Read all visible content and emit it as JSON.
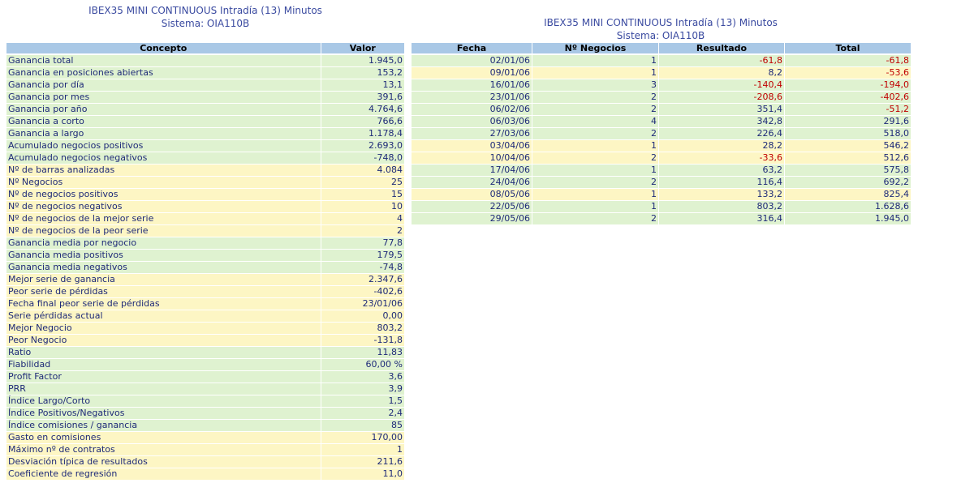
{
  "left": {
    "title": "IBEX35 MINI CONTINUOUS Intradía (13) Minutos",
    "subtitle": "Sistema: OIA110B",
    "headers": [
      "Concepto",
      "Valor"
    ],
    "rows": [
      {
        "label": "Ganancia total",
        "value": "1.945,0",
        "color": "g"
      },
      {
        "label": "Ganancia en posiciones abiertas",
        "value": "153,2",
        "color": "g"
      },
      {
        "label": "Ganancia por día",
        "value": "13,1",
        "color": "g"
      },
      {
        "label": "Ganancia por mes",
        "value": "391,6",
        "color": "g"
      },
      {
        "label": "Ganancia por año",
        "value": "4.764,6",
        "color": "g"
      },
      {
        "label": "Ganancia a corto",
        "value": "766,6",
        "color": "g"
      },
      {
        "label": "Ganancia a largo",
        "value": "1.178,4",
        "color": "g"
      },
      {
        "label": "Acumulado negocios positivos",
        "value": "2.693,0",
        "color": "g"
      },
      {
        "label": "Acumulado negocios negativos",
        "value": "-748,0",
        "color": "g"
      },
      {
        "label": "Nº de barras analizadas",
        "value": "4.084",
        "color": "y"
      },
      {
        "label": "Nº Negocios",
        "value": "25",
        "color": "y"
      },
      {
        "label": "Nº de negocios positivos",
        "value": "15",
        "color": "y"
      },
      {
        "label": "Nº de negocios negativos",
        "value": "10",
        "color": "y"
      },
      {
        "label": "Nº de negocios de la mejor serie",
        "value": "4",
        "color": "y"
      },
      {
        "label": "Nº de negocios de la peor serie",
        "value": "2",
        "color": "y"
      },
      {
        "label": "Ganancia media por negocio",
        "value": "77,8",
        "color": "g"
      },
      {
        "label": "Ganancia media positivos",
        "value": "179,5",
        "color": "g"
      },
      {
        "label": "Ganancia media negativos",
        "value": "-74,8",
        "color": "g"
      },
      {
        "label": "Mejor serie de ganancia",
        "value": "2.347,6",
        "color": "y"
      },
      {
        "label": "Peor serie de pérdidas",
        "value": "-402,6",
        "color": "y"
      },
      {
        "label": "Fecha final peor serie de pérdidas",
        "value": "23/01/06",
        "color": "y"
      },
      {
        "label": "Serie pérdidas actual",
        "value": "0,00",
        "color": "y"
      },
      {
        "label": "Mejor Negocio",
        "value": "803,2",
        "color": "y"
      },
      {
        "label": "Peor Negocio",
        "value": "-131,8",
        "color": "y"
      },
      {
        "label": "Ratio",
        "value": "11,83",
        "color": "g"
      },
      {
        "label": "Fiabilidad",
        "value": "60,00 %",
        "color": "g"
      },
      {
        "label": "Profit Factor",
        "value": "3,6",
        "color": "g"
      },
      {
        "label": "PRR",
        "value": "3,9",
        "color": "g"
      },
      {
        "label": "Índice Largo/Corto",
        "value": "1,5",
        "color": "g"
      },
      {
        "label": "Índice Positivos/Negativos",
        "value": "2,4",
        "color": "g"
      },
      {
        "label": "Índice comisiones / ganancia",
        "value": "85",
        "color": "g"
      },
      {
        "label": "Gasto en comisiones",
        "value": "170,00",
        "color": "y"
      },
      {
        "label": "Máximo nº de contratos",
        "value": "1",
        "color": "y"
      },
      {
        "label": "Desviación típica de resultados",
        "value": "211,6",
        "color": "y"
      },
      {
        "label": "Coeficiente de regresión",
        "value": "11,0",
        "color": "y"
      }
    ]
  },
  "right": {
    "title": "IBEX35 MINI CONTINUOUS Intradía (13) Minutos",
    "subtitle": "Sistema: OIA110B",
    "headers": [
      "Fecha",
      "Nº Negocios",
      "Resultado",
      "Total"
    ],
    "rows": [
      {
        "fecha": "02/01/06",
        "negocios": "1",
        "resultado": "-61,8",
        "total": "-61,8",
        "color": "g",
        "res_neg": true,
        "tot_neg": true
      },
      {
        "fecha": "09/01/06",
        "negocios": "1",
        "resultado": "8,2",
        "total": "-53,6",
        "color": "y",
        "res_neg": false,
        "tot_neg": true
      },
      {
        "fecha": "16/01/06",
        "negocios": "3",
        "resultado": "-140,4",
        "total": "-194,0",
        "color": "g",
        "res_neg": true,
        "tot_neg": true
      },
      {
        "fecha": "23/01/06",
        "negocios": "2",
        "resultado": "-208,6",
        "total": "-402,6",
        "color": "g",
        "res_neg": true,
        "tot_neg": true
      },
      {
        "fecha": "06/02/06",
        "negocios": "2",
        "resultado": "351,4",
        "total": "-51,2",
        "color": "g",
        "res_neg": false,
        "tot_neg": true
      },
      {
        "fecha": "06/03/06",
        "negocios": "4",
        "resultado": "342,8",
        "total": "291,6",
        "color": "g",
        "res_neg": false,
        "tot_neg": false
      },
      {
        "fecha": "27/03/06",
        "negocios": "2",
        "resultado": "226,4",
        "total": "518,0",
        "color": "g",
        "res_neg": false,
        "tot_neg": false
      },
      {
        "fecha": "03/04/06",
        "negocios": "1",
        "resultado": "28,2",
        "total": "546,2",
        "color": "y",
        "res_neg": false,
        "tot_neg": false
      },
      {
        "fecha": "10/04/06",
        "negocios": "2",
        "resultado": "-33,6",
        "total": "512,6",
        "color": "y",
        "res_neg": true,
        "tot_neg": false
      },
      {
        "fecha": "17/04/06",
        "negocios": "1",
        "resultado": "63,2",
        "total": "575,8",
        "color": "g",
        "res_neg": false,
        "tot_neg": false
      },
      {
        "fecha": "24/04/06",
        "negocios": "2",
        "resultado": "116,4",
        "total": "692,2",
        "color": "g",
        "res_neg": false,
        "tot_neg": false
      },
      {
        "fecha": "08/05/06",
        "negocios": "1",
        "resultado": "133,2",
        "total": "825,4",
        "color": "y",
        "res_neg": false,
        "tot_neg": false
      },
      {
        "fecha": "22/05/06",
        "negocios": "1",
        "resultado": "803,2",
        "total": "1.628,6",
        "color": "g",
        "res_neg": false,
        "tot_neg": false
      },
      {
        "fecha": "29/05/06",
        "negocios": "2",
        "resultado": "316,4",
        "total": "1.945,0",
        "color": "g",
        "res_neg": false,
        "tot_neg": false
      }
    ]
  }
}
